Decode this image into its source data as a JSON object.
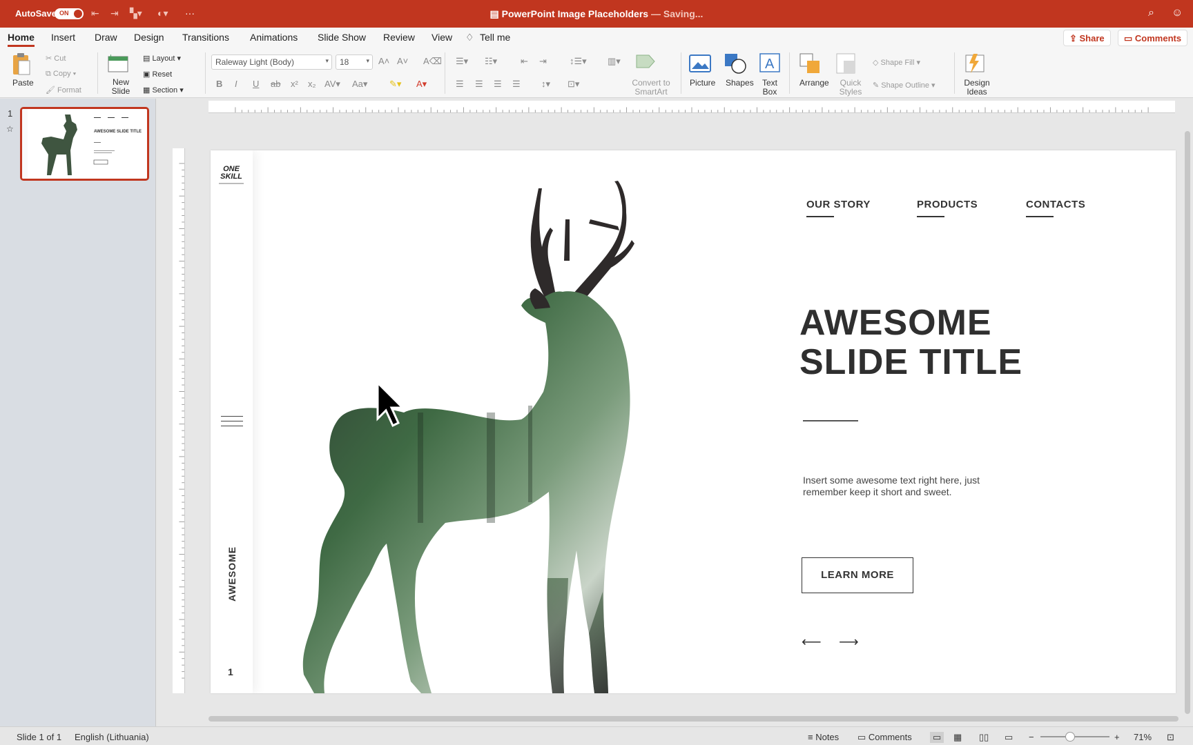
{
  "titlebar": {
    "autosave_label": "AutoSave",
    "autosave_state": "ON",
    "doc_title": "PowerPoint Image Placeholders",
    "save_status": " — Saving..."
  },
  "tabs": [
    "Home",
    "Insert",
    "Draw",
    "Design",
    "Transitions",
    "Animations",
    "Slide Show",
    "Review",
    "View",
    "Tell me"
  ],
  "share_label": "Share",
  "comments_label": "Comments",
  "ribbon": {
    "paste": "Paste",
    "cut": "Cut",
    "copy": "Copy",
    "format": "Format",
    "new_slide": "New Slide",
    "layout": "Layout",
    "reset": "Reset",
    "section": "Section",
    "font_name": "Raleway Light (Body)",
    "font_size": "18",
    "convert_smartart": "Convert to SmartArt",
    "picture": "Picture",
    "shapes": "Shapes",
    "text_box": "Text Box",
    "arrange": "Arrange",
    "quick_styles": "Quick Styles",
    "shape_fill": "Shape Fill",
    "shape_outline": "Shape Outline",
    "design_ideas": "Design Ideas"
  },
  "sidebar": {
    "slide_number": "1"
  },
  "thumbnail": {
    "title": "AWESOME SLIDE TITLE"
  },
  "slide": {
    "logo_line1": "ONE",
    "logo_line2": "SKILL",
    "vertical_text": "AWESOME",
    "page_number": "1",
    "nav": [
      "OUR STORY",
      "PRODUCTS",
      "CONTACTS"
    ],
    "title_line1": "AWESOME",
    "title_line2": "SLIDE TITLE",
    "body": "Insert some awesome text right here, just remember keep it short and sweet.",
    "button": "LEARN MORE",
    "prev_arrow": "⟵",
    "next_arrow": "⟶"
  },
  "status": {
    "slide_info": "Slide 1 of 1",
    "language": "English (Lithuania)",
    "notes": "Notes",
    "comments": "Comments",
    "zoom": "71%"
  },
  "colors": {
    "brand": "#c1361f",
    "text": "#2f2f2f"
  }
}
